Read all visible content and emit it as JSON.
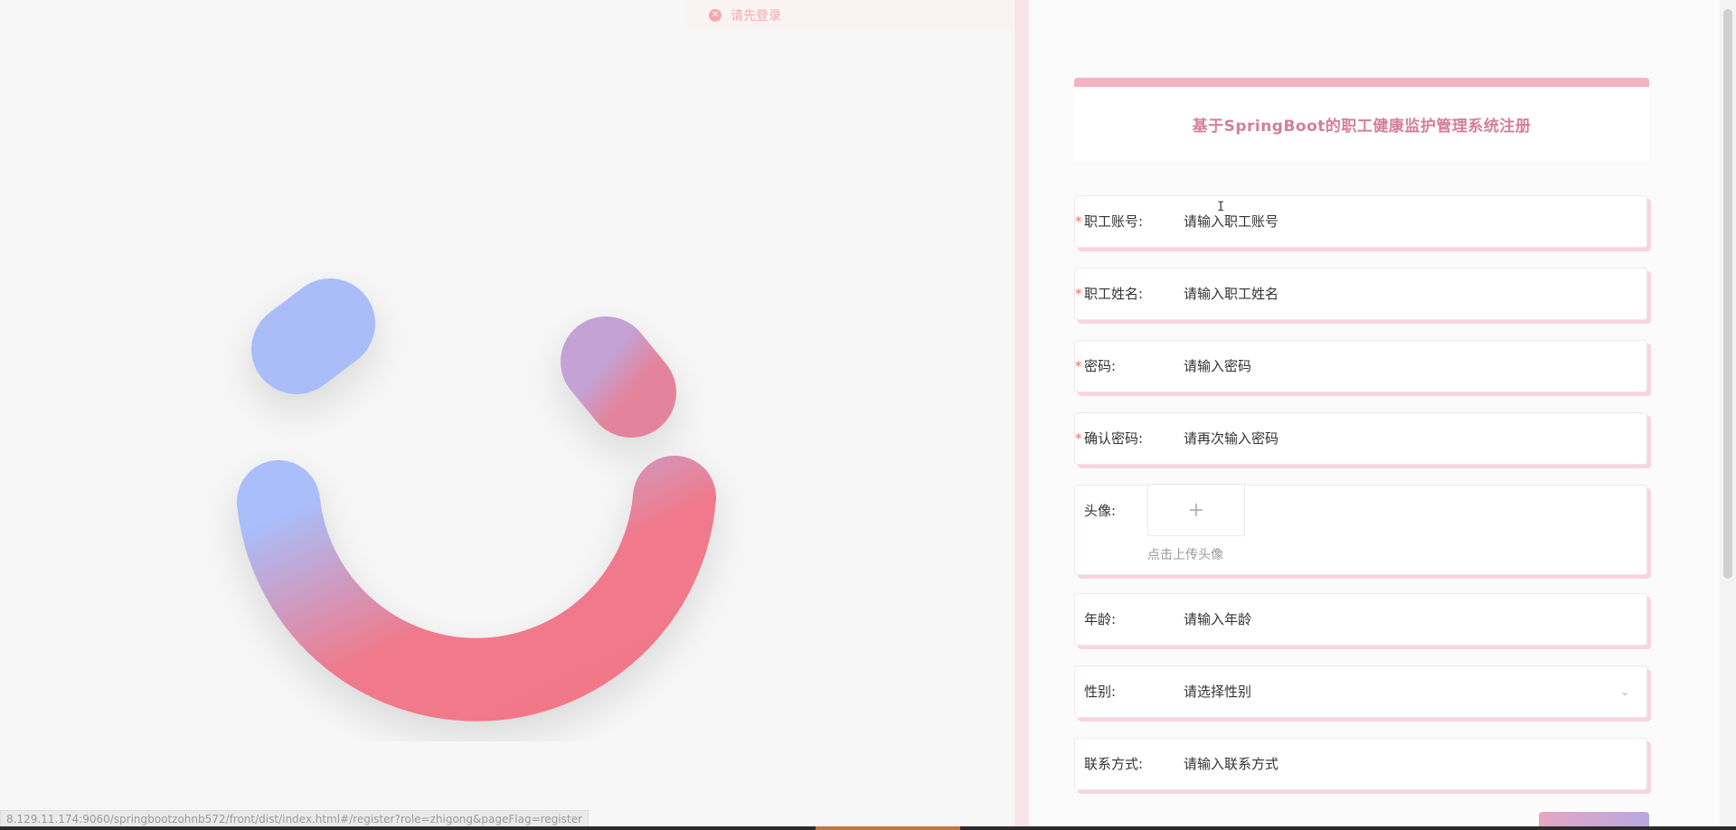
{
  "toast": {
    "message": "请先登录",
    "color": "#f56c6c"
  },
  "logo": {
    "name": "smile-logo",
    "gradient_start": "#a8bffa",
    "gradient_end": "#f07888"
  },
  "form": {
    "title": "基于SpringBoot的职工健康监护管理系统注册",
    "accent_color": "#f4b2c4",
    "fields": [
      {
        "label": "职工账号:",
        "placeholder": "请输入职工账号",
        "required": true
      },
      {
        "label": "职工姓名:",
        "placeholder": "请输入职工姓名",
        "required": true
      },
      {
        "label": "密码:",
        "placeholder": "请输入密码",
        "required": true
      },
      {
        "label": "确认密码:",
        "placeholder": "请再次输入密码",
        "required": true
      },
      {
        "label": "头像:",
        "upload_hint": "点击上传头像",
        "upload_icon": "plus-icon",
        "required": false
      },
      {
        "label": "年龄:",
        "placeholder": "请输入年龄",
        "required": false
      },
      {
        "label": "性别:",
        "placeholder": "请选择性别",
        "required": false,
        "type": "select",
        "arrow_icon": "chevron-down-icon"
      },
      {
        "label": "联系方式:",
        "placeholder": "请输入联系方式",
        "required": false
      }
    ],
    "required_mark": "*"
  },
  "status_bar": {
    "url": "8.129.11.174:9060/springbootzohnb572/front/dist/index.html#/register?role=zhigong&pageFlag=register"
  }
}
